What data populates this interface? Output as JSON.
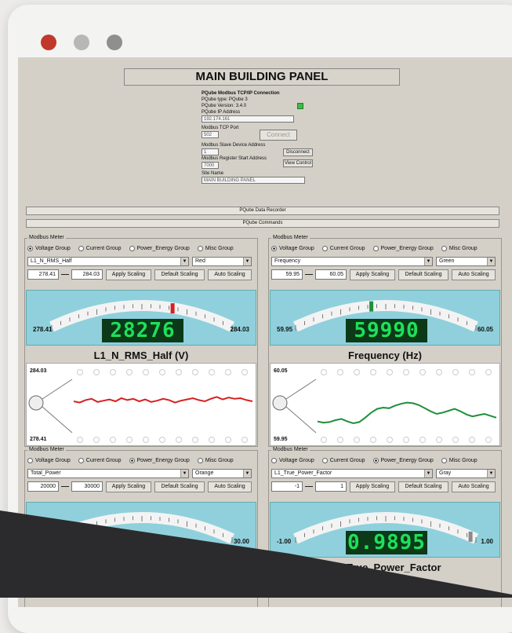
{
  "window": {
    "dot_colors": [
      "#c0392b",
      "#b7b7b7",
      "#8f8f8f"
    ]
  },
  "title": "MAIN BUILDING PANEL",
  "connection": {
    "heading": "PQube Modbus TCP/IP Connection",
    "type_line": "PQube type: PQube 3",
    "version_line": "PQube Version: 3.4.0",
    "ip_label": "PQube IP Address",
    "ip_value": "192.174.161",
    "port_label": "Modbus TCP Port",
    "port_value": "502",
    "connect_label": "Connect",
    "slave_label": "Modbus Slave Device Address",
    "slave_value": "1",
    "disconnect_label": "Disconnect",
    "start_label": "Modbus Register Start Address",
    "start_value": "7000",
    "view_control_label": "View Control",
    "site_label": "Site Name",
    "site_value": "MAIN BUILDING PANEL"
  },
  "bars": {
    "recorder": "PQube Data Recorder",
    "commands": "PQube Commands"
  },
  "meter_common": {
    "group_title": "Modbus Meter",
    "radio_labels": [
      "Voltage Group",
      "Current Group",
      "Power_Energy Group",
      "Misc Group"
    ],
    "apply_label": "Apply Scaling",
    "default_label": "Default Scaling",
    "auto_label": "Auto Scaling"
  },
  "meters": [
    {
      "selected_group": 0,
      "channel": "L1_N_RMS_Half",
      "color_name": "Red",
      "color": "#d62020",
      "min": "278.41",
      "max": "284.03",
      "reading": "28276",
      "needle_fraction": 0.67,
      "label": "L1_N_RMS_Half (V)",
      "trend_max": "284.03",
      "trend_min": "278.41"
    },
    {
      "selected_group": 0,
      "channel": "Frequency",
      "color_name": "Green",
      "color": "#1f8f3a",
      "min": "59.95",
      "max": "60.05",
      "reading": "59990",
      "needle_fraction": 0.42,
      "label": "Frequency (Hz)",
      "trend_max": "60.05",
      "trend_min": "59.95"
    },
    {
      "selected_group": 2,
      "channel": "Total_Power",
      "color_name": "Orange",
      "color": "#e07b1a",
      "min": "20000",
      "max": "30000",
      "gauge_max_text": "30.00"
    },
    {
      "selected_group": 2,
      "channel": "L1_True_Power_Factor",
      "color_name": "Gray",
      "color": "#8a8a8a",
      "min": "-1",
      "max": "1",
      "gauge_min_text": "-1.00",
      "gauge_max_text": "1.00",
      "reading": "0.9895",
      "needle_fraction": 0.97,
      "label": "L1_True_Power_Factor"
    }
  ],
  "trend_series": {
    "voltage": [
      0.4,
      0.42,
      0.38,
      0.36,
      0.41,
      0.39,
      0.37,
      0.4,
      0.35,
      0.38,
      0.36,
      0.4,
      0.37,
      0.41,
      0.39,
      0.36,
      0.38,
      0.42,
      0.39,
      0.37,
      0.35,
      0.38,
      0.4,
      0.36,
      0.33,
      0.37,
      0.34,
      0.36,
      0.35,
      0.38,
      0.4
    ],
    "frequency": [
      0.72,
      0.74,
      0.73,
      0.7,
      0.68,
      0.72,
      0.75,
      0.73,
      0.66,
      0.58,
      0.52,
      0.5,
      0.51,
      0.47,
      0.44,
      0.42,
      0.43,
      0.46,
      0.51,
      0.56,
      0.6,
      0.58,
      0.55,
      0.52,
      0.56,
      0.61,
      0.64,
      0.62,
      0.6,
      0.63,
      0.66
    ]
  }
}
